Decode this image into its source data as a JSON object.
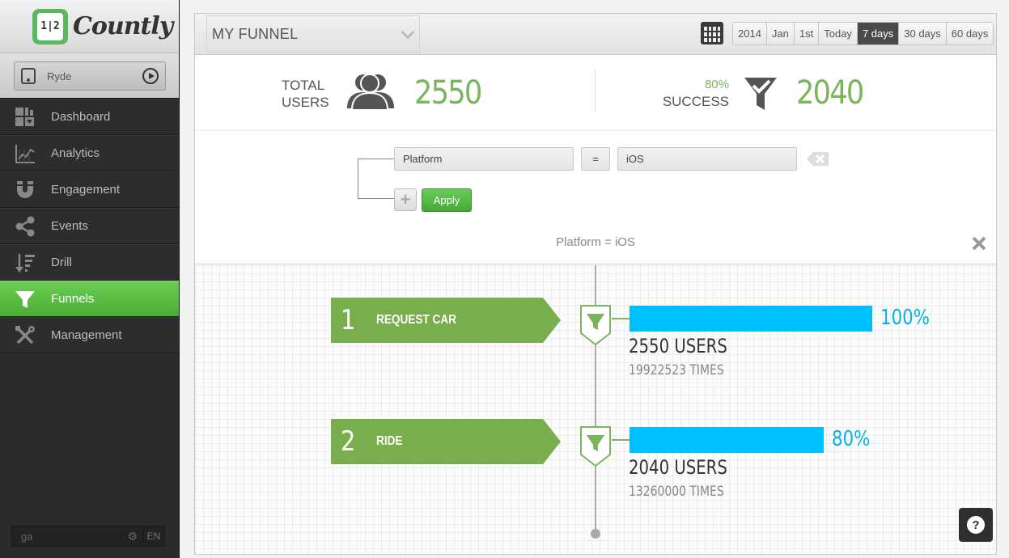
{
  "app": {
    "logo_text": "Countly",
    "logo_badge": "1|2"
  },
  "app_selector": {
    "name": "Ryde"
  },
  "sidebar": {
    "items": [
      {
        "label": "Dashboard",
        "icon": "dashboard-icon",
        "active": false
      },
      {
        "label": "Analytics",
        "icon": "analytics-icon",
        "active": false
      },
      {
        "label": "Engagement",
        "icon": "magnet-icon",
        "active": false
      },
      {
        "label": "Events",
        "icon": "share-icon",
        "active": false
      },
      {
        "label": "Drill",
        "icon": "drill-icon",
        "active": false
      },
      {
        "label": "Funnels",
        "icon": "funnel-icon",
        "active": true
      },
      {
        "label": "Management",
        "icon": "tools-icon",
        "active": false
      }
    ],
    "search_value": "ga",
    "language": "EN"
  },
  "header": {
    "funnel_name": "MY FUNNEL",
    "date_buttons": [
      "2014",
      "Jan",
      "1st",
      "Today",
      "7 days",
      "30 days",
      "60 days"
    ],
    "active_date": "7 days"
  },
  "stats": {
    "total_label_line1": "TOTAL",
    "total_label_line2": "USERS",
    "total_users": "2550",
    "success_pct": "80%",
    "success_label": "SUCCESS",
    "success_users": "2040"
  },
  "filter": {
    "property": "Platform",
    "operator": "=",
    "value": "iOS",
    "apply_label": "Apply",
    "add_symbol": "+",
    "summary": "Platform = iOS"
  },
  "steps": [
    {
      "number": "1",
      "name": "REQUEST CAR",
      "percent": 100,
      "percent_label": "100%",
      "users": "2550 USERS",
      "times": "19922523 TIMES"
    },
    {
      "number": "2",
      "name": "RIDE",
      "percent": 80,
      "percent_label": "80%",
      "users": "2040 USERS",
      "times": "13260000 TIMES"
    }
  ],
  "help": {
    "label": "?"
  },
  "colors": {
    "accent_green": "#7ab55c",
    "bar_blue": "#00bfff",
    "pct_blue": "#0ab2e8",
    "active_nav": "#5cbf45"
  }
}
